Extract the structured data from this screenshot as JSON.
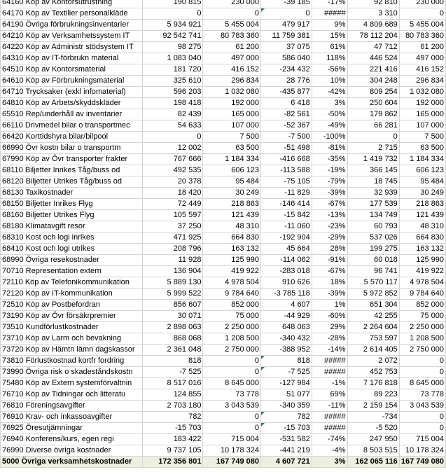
{
  "rows": [
    [
      "64160 Köp av Kontorsutrustning",
      "190 815",
      "230 000",
      "-39 185",
      "-17%",
      "92 810",
      "230 000"
    ],
    [
      "64170 Köp av Textilier personalkläde",
      "0",
      "0",
      "0",
      "#####",
      "3 310",
      "0"
    ],
    [
      "64190 Övriga förbrukningsinventarier",
      "5 934 921",
      "5 455 004",
      "479 917",
      "9%",
      "4 809 689",
      "5 455 004"
    ],
    [
      "64210 Köp av Verksamhetssystem IT",
      "92 542 741",
      "80 783 360",
      "11 759 381",
      "15%",
      "78 112 204",
      "80 783 360"
    ],
    [
      "64220 Köp av Administr stödsystem IT",
      "98 275",
      "61 200",
      "37 075",
      "61%",
      "47 712",
      "61 200"
    ],
    [
      "64310 Köp av IT-förbrukn material",
      "1 083 040",
      "497 000",
      "586 040",
      "118%",
      "446 524",
      "497 000"
    ],
    [
      "64510 Köp av Kontorsmaterial",
      "181 720",
      "416 152",
      "-234 432",
      "-56%",
      "221 416",
      "416 152"
    ],
    [
      "64610 Köp av Förbrukningsmaterial",
      "325 610",
      "296 834",
      "28 776",
      "10%",
      "304 248",
      "296 834"
    ],
    [
      "64710 Trycksaker (exkl infomaterial)",
      "596 203",
      "1 032 080",
      "-435 877",
      "-42%",
      "809 254",
      "1 032 080"
    ],
    [
      "64810 Köp av Arbets/skyddskläder",
      "198 418",
      "192 000",
      "6 418",
      "3%",
      "250 604",
      "192 000"
    ],
    [
      "65510 Rep/underhåll av inventarier",
      "82 439",
      "165 000",
      "-82 561",
      "-50%",
      "179 862",
      "165 000"
    ],
    [
      "66110 Drivmedel bilar o transportmec",
      "54 633",
      "107 000",
      "-52 367",
      "-49%",
      "66 281",
      "107 000"
    ],
    [
      "66420 Korttidshyra bilar/bilpool",
      "0",
      "7 500",
      "-7 500",
      "-100%",
      "0",
      "7 500"
    ],
    [
      "66990 Övr kostn bilar o transportm",
      "12 002",
      "63 500",
      "-51 498",
      "-81%",
      "2 715",
      "63 500"
    ],
    [
      "67990 Köp av Övr transporter frakter",
      "767 666",
      "1 184 334",
      "-416 668",
      "-35%",
      "1 419 732",
      "1 184 334"
    ],
    [
      "68110 Biljetter Inrikes Tåg/buss od",
      "492 535",
      "606 123",
      "-113 588",
      "-19%",
      "366 145",
      "606 123"
    ],
    [
      "68120 Biljetter Utrikes Tåg/buss od",
      "20 378",
      "95 484",
      "-75 105",
      "-79%",
      "18 745",
      "95 484"
    ],
    [
      "68130 Taxikostnader",
      "18 420",
      "30 249",
      "-11 829",
      "-39%",
      "32 939",
      "30 249"
    ],
    [
      "68150 Biljetter Inrikes Flyg",
      "72 449",
      "218 863",
      "-146 414",
      "-67%",
      "177 539",
      "218 863"
    ],
    [
      "68160 Biljetter Utrikes Flyg",
      "105 597",
      "121 439",
      "-15 842",
      "-13%",
      "134 749",
      "121 439"
    ],
    [
      "68180 Klimatavgift resor",
      "37 250",
      "48 310",
      "-11 060",
      "-23%",
      "60 793",
      "48 310"
    ],
    [
      "68310 Kost och logi inrikes",
      "471 925",
      "664 830",
      "-192 904",
      "-29%",
      "537 026",
      "664 830"
    ],
    [
      "68410 Kost och logi utrikes",
      "208 796",
      "163 132",
      "45 664",
      "28%",
      "199 275",
      "163 132"
    ],
    [
      "68990 Övriga resekostnader",
      "11 928",
      "125 990",
      "-114 062",
      "-91%",
      "60 018",
      "125 990"
    ],
    [
      "70710 Representation extern",
      "136 904",
      "419 922",
      "-283 018",
      "-67%",
      "96 741",
      "419 922"
    ],
    [
      "72110 Köp av Telefonikommunikation",
      "5 889 130",
      "4 978 504",
      "910 626",
      "18%",
      "5 570 117",
      "4 978 504"
    ],
    [
      "72120 Köp av IT-kommunikation",
      "5 999 522",
      "9 784 640",
      "-3 785 118",
      "-39%",
      "5 972 852",
      "9 784 640"
    ],
    [
      "72510 Köp av Postbefordran",
      "856 607",
      "852 000",
      "4 607",
      "1%",
      "651 304",
      "852 000"
    ],
    [
      "73190 Köp av Övr försäkrpremier",
      "30 071",
      "75 000",
      "-44 929",
      "-60%",
      "42 255",
      "75 000"
    ],
    [
      "73510 Kundförlustkostnader",
      "2 898 063",
      "2 250 000",
      "648 063",
      "29%",
      "2 264 604",
      "2 250 000"
    ],
    [
      "73710 Köp av Larm och bevakning",
      "868 068",
      "1 208 500",
      "-340 432",
      "-28%",
      "753 597",
      "1 208 500"
    ],
    [
      "73720 Köp av Hämtn lämn dagskassor",
      "2 361 048",
      "2 750 000",
      "-388 952",
      "-14%",
      "2 614 405",
      "2 750 000"
    ],
    [
      "73810 Förlustkostnad kortfr fordring",
      "818",
      "0",
      "818",
      "#####",
      "2 072",
      "0"
    ],
    [
      "73990 Övriga risk o skadeståndskostn",
      "-7 525",
      "0",
      "-7 525",
      "#####",
      "452 753",
      "0"
    ],
    [
      "75480 Köp av Extern systemförvaltnin",
      "8 517 016",
      "8 645 000",
      "-127 984",
      "-1%",
      "7 176 818",
      "8 645 000"
    ],
    [
      "76710 Köp av Tidningar och litteratu",
      "124 855",
      "73 778",
      "51 077",
      "69%",
      "89 223",
      "73 778"
    ],
    [
      "76810 Föreningsavgifter",
      "2 703 180",
      "3 043 539",
      "-340 359",
      "-11%",
      "2 159 154",
      "3 043 539"
    ],
    [
      "76910 Krav- och inkassoavgifter",
      "782",
      "0",
      "782",
      "#####",
      "-734",
      "0"
    ],
    [
      "76925 Öresutjämningar",
      "-15 703",
      "0",
      "-15 703",
      "#####",
      "-5 520",
      "0"
    ],
    [
      "76940 Konferens/kurs, egen regi",
      "183 422",
      "715 004",
      "-531 582",
      "-74%",
      "247 950",
      "715 004"
    ],
    [
      "76990 Diverse övriga kostnader",
      "9 737 105",
      "10 178 324",
      "-441 219",
      "-4%",
      "8 503 515",
      "10 178 324"
    ]
  ],
  "total": [
    "5000 Övriga verksamhetskostnader",
    "172 356 801",
    "167 749 080",
    "4 607 721",
    "3%",
    "162 065 116",
    "167 749 080"
  ],
  "flag_color": "#1e8c3a",
  "total_bg": "#ebf1de"
}
